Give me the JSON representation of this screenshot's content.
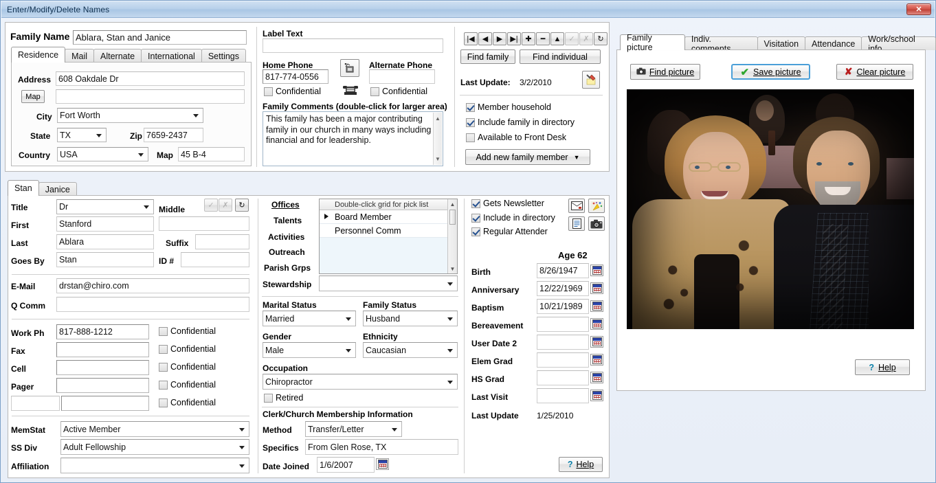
{
  "window": {
    "title": "Enter/Modify/Delete Names",
    "close_label": "✕"
  },
  "family": {
    "name_label": "Family Name",
    "name_value": "Ablara, Stan and Janice",
    "tabs": [
      {
        "label": "Residence",
        "active": true
      },
      {
        "label": "Mail",
        "active": false
      },
      {
        "label": "Alternate",
        "active": false
      },
      {
        "label": "International",
        "active": false
      },
      {
        "label": "Settings",
        "active": false
      }
    ],
    "address_label": "Address",
    "address_value": "608 Oakdale Dr",
    "map_button": "Map",
    "address2_value": "",
    "city_label": "City",
    "city_value": "Fort Worth",
    "state_label": "State",
    "state_value": "TX",
    "zip_label": "Zip",
    "zip_value": "7659-2437",
    "country_label": "Country",
    "country_value": "USA",
    "map_label": "Map",
    "map_value": "45 B-4"
  },
  "contact": {
    "label_text_label": "Label Text",
    "label_text_value": "",
    "home_phone_label": "Home Phone",
    "home_phone_value": "817-774-0556",
    "home_confidential_label": "Confidential",
    "home_confidential_checked": false,
    "alt_phone_label": "Alternate Phone",
    "alt_phone_value": "",
    "alt_confidential_label": "Confidential",
    "alt_confidential_checked": false,
    "comments_label": "Family Comments",
    "comments_hint": "(double-click for larger area)",
    "comments_value": "This family has been a major contributing family in our church in many ways including financial and for leadership."
  },
  "navigator": {
    "buttons": [
      {
        "name": "first",
        "glyph": "|◀",
        "disabled": false
      },
      {
        "name": "prev",
        "glyph": "◀",
        "disabled": false
      },
      {
        "name": "next",
        "glyph": "▶",
        "disabled": false
      },
      {
        "name": "last",
        "glyph": "▶|",
        "disabled": false
      },
      {
        "name": "add",
        "glyph": "✚",
        "disabled": false
      },
      {
        "name": "delete",
        "glyph": "━",
        "disabled": false
      },
      {
        "name": "edit",
        "glyph": "▲",
        "disabled": false
      },
      {
        "name": "post",
        "glyph": "✓",
        "disabled": true
      },
      {
        "name": "cancel",
        "glyph": "✗",
        "disabled": true
      },
      {
        "name": "refresh",
        "glyph": "↻",
        "disabled": false
      }
    ],
    "find_family": "Find family",
    "find_individual": "Find individual",
    "last_update_label": "Last Update:",
    "last_update_value": "3/2/2010",
    "checkboxes": [
      {
        "label": "Member household",
        "checked": true
      },
      {
        "label": "Include family in directory",
        "checked": true
      },
      {
        "label": "Available to Front Desk",
        "checked": false
      }
    ],
    "add_member_button": "Add new family member"
  },
  "person": {
    "tabs": [
      {
        "label": "Stan",
        "active": true
      },
      {
        "label": "Janice",
        "active": false
      }
    ],
    "title_label": "Title",
    "title_value": "Dr",
    "middle_label": "Middle",
    "middle_value": "",
    "first_label": "First",
    "first_value": "Stanford",
    "last_label": "Last",
    "last_value": "Ablara",
    "suffix_label": "Suffix",
    "suffix_value": "",
    "goes_by_label": "Goes By",
    "goes_by_value": "Stan",
    "id_label": "ID #",
    "id_value": "",
    "email_label": "E-Mail",
    "email_value": "drstan@chiro.com",
    "qcomm_label": "Q Comm",
    "qcomm_value": "",
    "phones": [
      {
        "label": "Work Ph",
        "value": "817-888-1212",
        "confidential_label": "Confidential",
        "confidential_checked": false
      },
      {
        "label": "Fax",
        "value": "",
        "confidential_label": "Confidential",
        "confidential_checked": false
      },
      {
        "label": "Cell",
        "value": "",
        "confidential_label": "Confidential",
        "confidential_checked": false
      },
      {
        "label": "Pager",
        "value": "",
        "confidential_label": "Confidential",
        "confidential_checked": false
      },
      {
        "label": "",
        "value": "",
        "confidential_label": "Confidential",
        "confidential_checked": false
      }
    ],
    "memstat_label": "MemStat",
    "memstat_value": "Active Member",
    "ssdiv_label": "SS Div",
    "ssdiv_value": "Adult Fellowship",
    "affiliation_label": "Affiliation",
    "affiliation_value": ""
  },
  "involvement": {
    "categories": [
      {
        "label": "Offices",
        "active": true
      },
      {
        "label": "Talents",
        "active": false
      },
      {
        "label": "Activities",
        "active": false
      },
      {
        "label": "Outreach",
        "active": false
      },
      {
        "label": "Parish Grps",
        "active": false
      }
    ],
    "grid_header": "Double-click grid for pick list",
    "grid_rows": [
      "Board Member",
      "Personnel Comm"
    ],
    "stewardship_label": "Stewardship",
    "stewardship_value": "",
    "marital_status_label": "Marital Status",
    "marital_status_value": "Married",
    "family_status_label": "Family Status",
    "family_status_value": "Husband",
    "gender_label": "Gender",
    "gender_value": "Male",
    "ethnicity_label": "Ethnicity",
    "ethnicity_value": "Caucasian",
    "occupation_label": "Occupation",
    "occupation_value": "Chiropractor",
    "retired_label": "Retired",
    "retired_checked": false,
    "membership_header": "Clerk/Church Membership Information",
    "method_label": "Method",
    "method_value": "Transfer/Letter",
    "specifics_label": "Specifics",
    "specifics_value": "From Glen Rose, TX",
    "date_joined_label": "Date Joined",
    "date_joined_value": "1/6/2007"
  },
  "dates": {
    "checkboxes": [
      {
        "label": "Gets Newsletter",
        "checked": true
      },
      {
        "label": "Include in directory",
        "checked": true
      },
      {
        "label": "Regular Attender",
        "checked": true
      }
    ],
    "icons": [
      "envelope-icon",
      "celebration-icon",
      "document-icon",
      "camera-icon"
    ],
    "age_label": "Age 62",
    "rows": [
      {
        "label": "Birth",
        "value": "8/26/1947"
      },
      {
        "label": "Anniversary",
        "value": "12/22/1969"
      },
      {
        "label": "Baptism",
        "value": "10/21/1989"
      },
      {
        "label": "Bereavement",
        "value": ""
      },
      {
        "label": "User Date 2",
        "value": ""
      },
      {
        "label": "Elem Grad",
        "value": ""
      },
      {
        "label": "HS Grad",
        "value": ""
      },
      {
        "label": "Last Visit",
        "value": ""
      }
    ],
    "last_update_label": "Last Update",
    "last_update_value": "1/25/2010",
    "help_button": "Help"
  },
  "picture": {
    "tabs": [
      {
        "label": "Family picture",
        "active": true
      },
      {
        "label": "Indiv. comments",
        "active": false
      },
      {
        "label": "Visitation",
        "active": false
      },
      {
        "label": "Attendance",
        "active": false
      },
      {
        "label": "Work/school info",
        "active": false
      }
    ],
    "find_button": "Find picture",
    "save_button": "Save picture",
    "clear_button": "Clear picture",
    "help_button": "Help",
    "image_alt": "Photograph of a smiling couple seated at a dimly lit banquet table"
  },
  "colors": {
    "accent": "#4a9fd8",
    "title_text": "#11314f",
    "close_red": "#c04339",
    "check_blue": "#24508f"
  }
}
